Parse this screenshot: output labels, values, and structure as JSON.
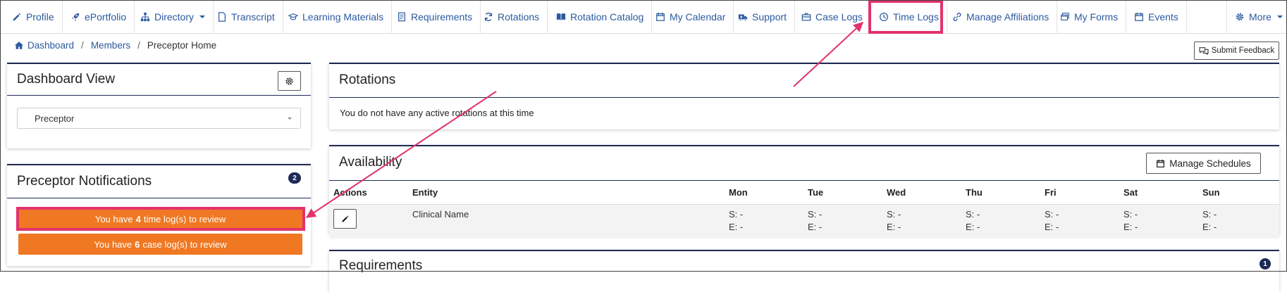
{
  "nav": {
    "profile": "Profile",
    "eportfolio": "ePortfolio",
    "directory": "Directory",
    "transcript": "Transcript",
    "learning_materials": "Learning Materials",
    "requirements": "Requirements",
    "rotations": "Rotations",
    "rotation_catalog": "Rotation Catalog",
    "my_calendar": "My Calendar",
    "support": "Support",
    "case_logs": "Case Logs",
    "time_logs": "Time Logs",
    "manage_affiliations": "Manage Affiliations",
    "my_forms": "My Forms",
    "events": "Events",
    "more": "More"
  },
  "breadcrumb": {
    "dashboard": "Dashboard",
    "members": "Members",
    "current": "Preceptor Home",
    "separator": "/"
  },
  "submit_feedback": "Submit Feedback",
  "dashboard_view": {
    "title": "Dashboard View",
    "selected": "Preceptor"
  },
  "notifications": {
    "title": "Preceptor Notifications",
    "count": "2",
    "time_log": {
      "prefix": "You have",
      "count": "4",
      "suffix": "time log(s) to review"
    },
    "case_log": {
      "prefix": "You have",
      "count": "6",
      "suffix": "case log(s) to review"
    }
  },
  "rotations": {
    "title": "Rotations",
    "empty_message": "You do not have any active rotations at this time"
  },
  "availability": {
    "title": "Availability",
    "manage_label": "Manage Schedules",
    "headers": [
      "Actions",
      "Entity",
      "Mon",
      "Tue",
      "Wed",
      "Thu",
      "Fri",
      "Sat",
      "Sun"
    ],
    "row": {
      "entity": "Clinical Name",
      "days": [
        {
          "start": "S: -",
          "end": "E: -"
        },
        {
          "start": "S: -",
          "end": "E: -"
        },
        {
          "start": "S: -",
          "end": "E: -"
        },
        {
          "start": "S: -",
          "end": "E: -"
        },
        {
          "start": "S: -",
          "end": "E: -"
        },
        {
          "start": "S: -",
          "end": "E: -"
        },
        {
          "start": "S: -",
          "end": "E: -"
        }
      ]
    }
  },
  "requirements": {
    "title": "Requirements",
    "count": "1"
  },
  "colors": {
    "link": "#2c5aa0",
    "card_rule": "#1e2a55",
    "notification_button": "#f07822",
    "annotation": "#e2336b"
  }
}
